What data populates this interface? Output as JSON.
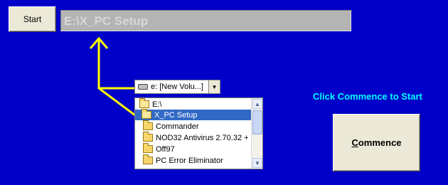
{
  "toolbar": {
    "start_label": "Start",
    "path_value": "E:\\X_PC Setup"
  },
  "drive": {
    "selected": "e: [New Volu...]"
  },
  "directories": [
    {
      "label": "E:\\",
      "state": "open"
    },
    {
      "label": "X_PC Setup",
      "state": "open",
      "selected": true
    },
    {
      "label": "Commander",
      "state": "closed"
    },
    {
      "label": "NOD32 Antivirus 2.70.32 + ",
      "state": "closed"
    },
    {
      "label": "Off97",
      "state": "closed"
    },
    {
      "label": "PC Error Eliminator",
      "state": "closed"
    }
  ],
  "hint": {
    "text": "Click Commence to Start"
  },
  "commence": {
    "mnemonic": "C",
    "rest": "ommence"
  },
  "colors": {
    "background": "#0000c8",
    "arrow": "#ffff00",
    "hint": "#00ffff",
    "selection": "#316ac5"
  },
  "icons": {
    "drive": "drive-icon",
    "folder": "folder-icon",
    "open_folder": "open-folder-icon",
    "dropdown": "chevron-down-icon",
    "arrow": "arrow-up-icon"
  }
}
